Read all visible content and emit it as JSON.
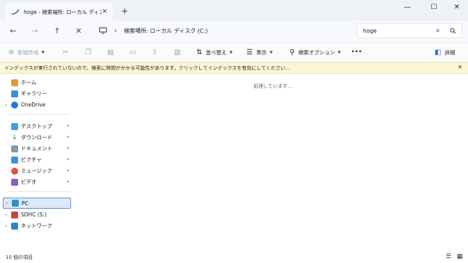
{
  "window": {
    "tab_title": "hoge - 検索場所: ローカル ディスク (C:)",
    "tab_close": "✕",
    "new_tab": "+",
    "minimize": "—",
    "maximize": "☐",
    "close": "✕"
  },
  "nav": {
    "back": "←",
    "forward": "→",
    "up": "↑",
    "cancel": "✕",
    "breadcrumb_sep": "›",
    "address": "検索場所: ローカル ディスク (C:)"
  },
  "search": {
    "value": "hoge",
    "clear": "✕"
  },
  "toolbar": {
    "new_label": "新規作成",
    "sort_label": "並べ替え",
    "view_label": "表示",
    "search_options_label": "検索オプション",
    "more": "•••",
    "details_label": "詳細"
  },
  "infobar": {
    "message": "インデックスが実行されていないので、検索に時間がかかる可能性があります。クリックしてインデックスを有効にしてください...",
    "close": "✕"
  },
  "sidebar": {
    "items": [
      {
        "label": "ホーム"
      },
      {
        "label": "ギャラリー"
      },
      {
        "label": "OneDrive"
      },
      {
        "label": "デスクトップ"
      },
      {
        "label": "ダウンロード"
      },
      {
        "label": "ドキュメント"
      },
      {
        "label": "ピクチャ"
      },
      {
        "label": "ミュージック"
      },
      {
        "label": "ビデオ"
      },
      {
        "label": "PC"
      },
      {
        "label": "SDHC (S:)"
      },
      {
        "label": "ネットワーク"
      }
    ]
  },
  "content": {
    "status": "処理しています..."
  },
  "statusbar": {
    "count": "10 個の項目"
  },
  "colors": {
    "accent": "#5b8fd0",
    "infobar_bg": "#fbf7d5",
    "selection_bg": "#dbe9f8"
  }
}
